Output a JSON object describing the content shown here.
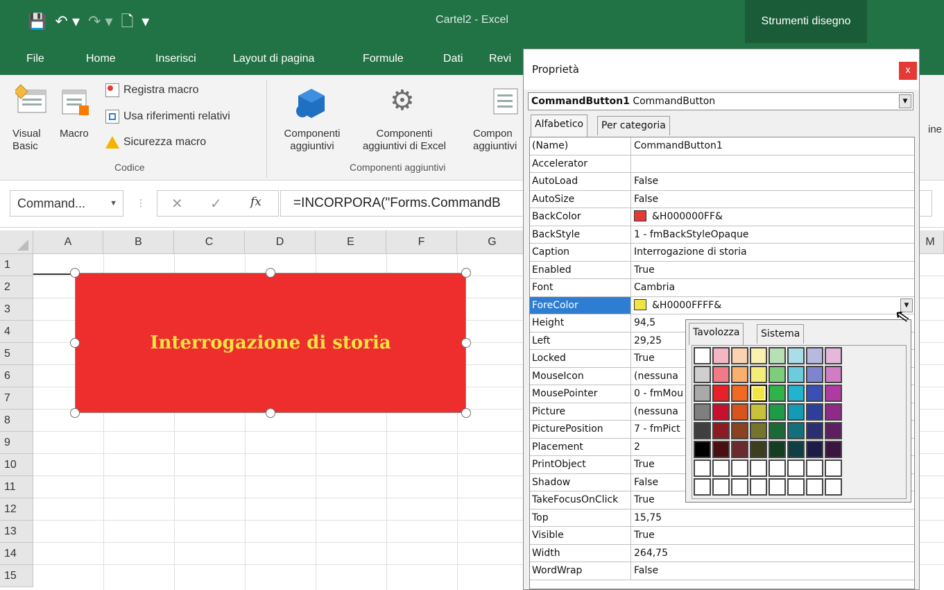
{
  "app": {
    "title": "Cartel2  -  Excel",
    "contextual_tab": "Strumenti disegno",
    "qat": {
      "save": "💾",
      "undo": "↶ ▾",
      "redo": "↷ ▾",
      "new": "🗋",
      "customize": "▾"
    }
  },
  "ribbon_tabs": [
    "File",
    "Home",
    "Inserisci",
    "Layout di pagina",
    "Formule",
    "Dati",
    "Revi"
  ],
  "ribbon": {
    "codice": {
      "visual_basic": "Visual\nBasic",
      "macro": "Macro",
      "registra_macro": "Registra macro",
      "usa_riferimenti": "Usa riferimenti relativi",
      "sicurezza_macro": "Sicurezza macro",
      "caption": "Codice"
    },
    "componenti": {
      "componenti_aggiuntivi": "Componenti\naggiuntivi",
      "componenti_excel": "Componenti\naggiuntivi di Excel",
      "componenti_com": "Compon\naggiuntivi",
      "caption": "Componenti aggiuntivi"
    },
    "clip_right": "ine"
  },
  "formula_bar": {
    "name_box": "Command...",
    "cancel": "✕",
    "enter": "✓",
    "fx": "fx",
    "formula": "=INCORPORA(\"Forms.CommandB"
  },
  "sheet": {
    "columns": [
      "A",
      "B",
      "C",
      "D",
      "E",
      "F",
      "G"
    ],
    "rows": [
      "1",
      "2",
      "3",
      "4",
      "5",
      "6",
      "7",
      "8",
      "9",
      "10",
      "11",
      "12",
      "13",
      "14",
      "15"
    ],
    "col_clip_right": "M"
  },
  "command_button": {
    "caption": "Interrogazione di storia",
    "back_color": "#ee2d2d",
    "fore_color": "#f2e442"
  },
  "properties_dialog": {
    "title": "Proprietà",
    "close": "x",
    "object_name": "CommandButton1",
    "object_type": "CommandButton",
    "tabs": [
      "Alfabetico",
      "Per categoria"
    ],
    "rows": [
      {
        "name": "(Name)",
        "value": "CommandButton1"
      },
      {
        "name": "Accelerator",
        "value": ""
      },
      {
        "name": "AutoLoad",
        "value": "False"
      },
      {
        "name": "AutoSize",
        "value": "False"
      },
      {
        "name": "BackColor",
        "value": "&H000000FF&",
        "swatch": "#e53935"
      },
      {
        "name": "BackStyle",
        "value": "1 - fmBackStyleOpaque"
      },
      {
        "name": "Caption",
        "value": "Interrogazione di storia"
      },
      {
        "name": "Enabled",
        "value": "True"
      },
      {
        "name": "Font",
        "value": "Cambria"
      },
      {
        "name": "ForeColor",
        "value": "&H0000FFFF&",
        "swatch": "#f2e442",
        "selected": true
      },
      {
        "name": "Height",
        "value": "94,5"
      },
      {
        "name": "Left",
        "value": "29,25"
      },
      {
        "name": "Locked",
        "value": "True"
      },
      {
        "name": "MouseIcon",
        "value": "(nessuna"
      },
      {
        "name": "MousePointer",
        "value": "0 - fmMou"
      },
      {
        "name": "Picture",
        "value": "(nessuna"
      },
      {
        "name": "PicturePosition",
        "value": "7 - fmPict"
      },
      {
        "name": "Placement",
        "value": "2"
      },
      {
        "name": "PrintObject",
        "value": "True"
      },
      {
        "name": "Shadow",
        "value": "False"
      },
      {
        "name": "TakeFocusOnClick",
        "value": "True"
      },
      {
        "name": "Top",
        "value": "15,75"
      },
      {
        "name": "Visible",
        "value": "True"
      },
      {
        "name": "Width",
        "value": "264,75"
      },
      {
        "name": "WordWrap",
        "value": "False"
      }
    ]
  },
  "color_palette": {
    "tabs": [
      "Tavolozza",
      "Sistema"
    ],
    "colors": [
      [
        "#ffffff",
        "#f4b6c2",
        "#fbd3b0",
        "#f8f1b0",
        "#b9e0b5",
        "#a9dde8",
        "#b7b9e0",
        "#e6b7dc"
      ],
      [
        "#cfcfcf",
        "#f07a86",
        "#f9b06f",
        "#f4ec7b",
        "#7fcd7a",
        "#6ccbdc",
        "#7d86cc",
        "#d07dc4"
      ],
      [
        "#a9a9a9",
        "#e8202a",
        "#f26a21",
        "#f2e442",
        "#2fb34a",
        "#22b3ce",
        "#3b4fb4",
        "#b03aa2"
      ],
      [
        "#7f7f7f",
        "#c8102e",
        "#d9531e",
        "#c9c13a",
        "#1e9b46",
        "#139ab4",
        "#2d3f9a",
        "#8e2a87"
      ],
      [
        "#3f3f3f",
        "#8c1c23",
        "#8a4220",
        "#74742c",
        "#1b6a36",
        "#136f7a",
        "#2b2f72",
        "#5e1f62"
      ],
      [
        "#000000",
        "#4a0f12",
        "#6b2a2e",
        "#3d3d1f",
        "#143d22",
        "#0f3f45",
        "#1d1b48",
        "#3b1540"
      ],
      [
        "#ffffff",
        "#ffffff",
        "#ffffff",
        "#ffffff",
        "#ffffff",
        "#ffffff",
        "#ffffff",
        "#ffffff"
      ],
      [
        "#ffffff",
        "#ffffff",
        "#ffffff",
        "#ffffff",
        "#ffffff",
        "#ffffff",
        "#ffffff",
        "#ffffff"
      ]
    ],
    "selected": [
      2,
      3
    ]
  },
  "colors": {
    "excel_green": "#217346",
    "selection_blue": "#2d7dd2"
  }
}
